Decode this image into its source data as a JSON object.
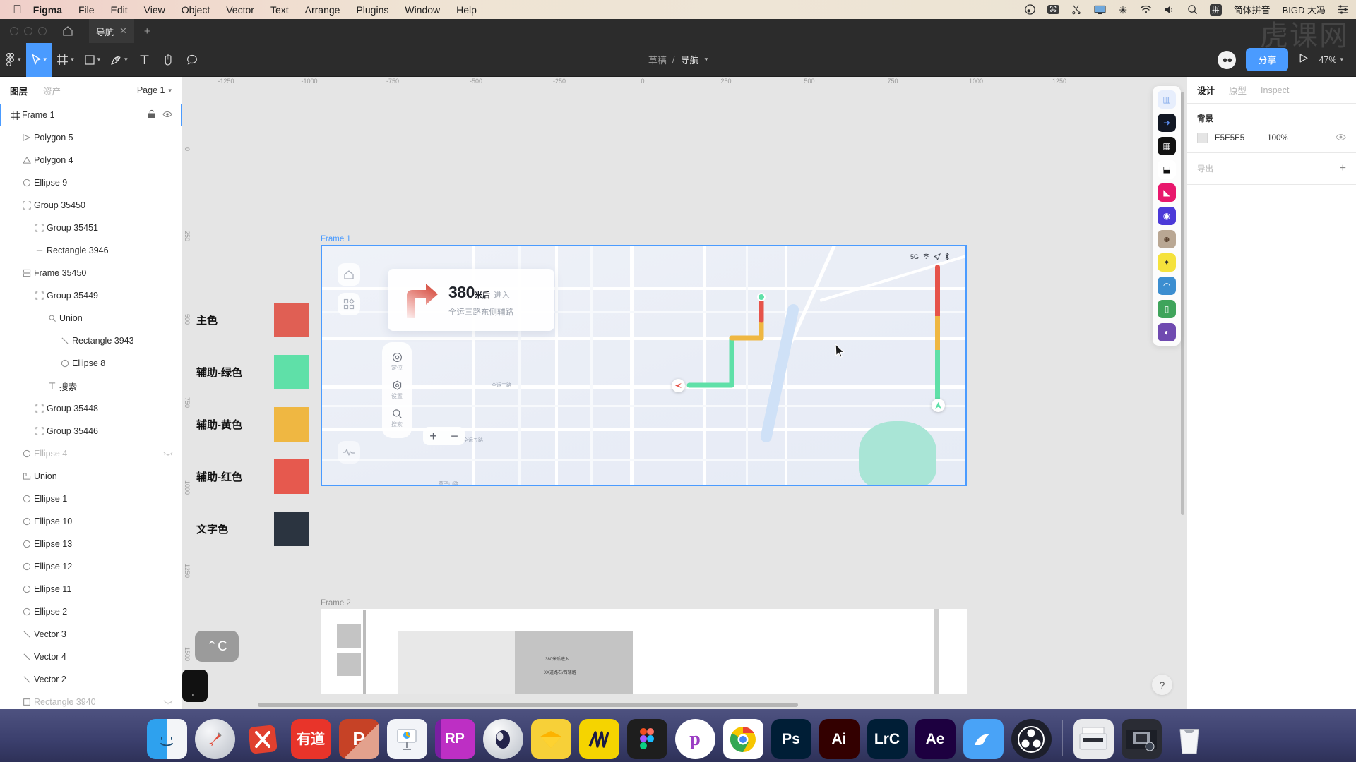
{
  "menubar": {
    "apple_icon": "apple-icon",
    "app_name": "Figma",
    "items": [
      "File",
      "Edit",
      "View",
      "Object",
      "Vector",
      "Text",
      "Arrange",
      "Plugins",
      "Window",
      "Help"
    ],
    "right_items": [
      {
        "name": "dropbox-icon",
        "glyph": "◍"
      },
      {
        "name": "command-key-icon",
        "glyph": "⌘"
      },
      {
        "name": "scissors-icon",
        "glyph": "✂"
      },
      {
        "name": "display-icon",
        "glyph": "🖵"
      },
      {
        "name": "airplay-icon",
        "glyph": "✛"
      },
      {
        "name": "wifi-icon",
        "glyph": "≋"
      },
      {
        "name": "volume-icon",
        "glyph": "◁"
      },
      {
        "name": "spotlight-search-icon",
        "glyph": "⌕"
      }
    ],
    "input_badge": "拼",
    "input_method": "简体拼音",
    "user_name": "BIGD 大冯",
    "control_center_icon": "control-center-icon"
  },
  "tabbar": {
    "tab_label": "导航",
    "close_glyph": "✕",
    "new_tab_glyph": "+",
    "home_icon": "figma-home-icon",
    "watermark": "虎课网"
  },
  "toolbar": {
    "tools": [
      {
        "name": "figma-menu-icon",
        "caret": true,
        "active": false
      },
      {
        "name": "move-tool-icon",
        "caret": true,
        "active": true
      },
      {
        "name": "frame-tool-icon",
        "caret": true,
        "active": false
      },
      {
        "name": "shape-tool-icon",
        "caret": true,
        "active": false
      },
      {
        "name": "pen-tool-icon",
        "caret": true,
        "active": false
      },
      {
        "name": "text-tool-icon",
        "caret": false,
        "active": false
      },
      {
        "name": "hand-tool-icon",
        "caret": false,
        "active": false
      },
      {
        "name": "comment-tool-icon",
        "caret": false,
        "active": false
      }
    ],
    "breadcrumb_project": "草稿",
    "breadcrumb_separator": "/",
    "breadcrumb_file": "导航",
    "share_label": "分享",
    "present_icon": "play-icon",
    "zoom_level": "47%"
  },
  "left_panel": {
    "tab_layers": "图层",
    "tab_assets": "资产",
    "page_name": "Page 1",
    "layers": [
      {
        "name": "Frame 1",
        "indent": 0,
        "icon": "frame-icon",
        "selected": true,
        "hidden": false,
        "locked": true,
        "eye": true
      },
      {
        "name": "Polygon 5",
        "indent": 1,
        "icon": "polygon-icon",
        "selected": false,
        "hidden": false
      },
      {
        "name": "Polygon 4",
        "indent": 1,
        "icon": "triangle-icon",
        "selected": false,
        "hidden": false
      },
      {
        "name": "Ellipse 9",
        "indent": 1,
        "icon": "ellipse-icon",
        "selected": false,
        "hidden": false
      },
      {
        "name": "Group 35450",
        "indent": 1,
        "icon": "group-icon",
        "selected": false,
        "hidden": false
      },
      {
        "name": "Group 35451",
        "indent": 2,
        "icon": "group-icon",
        "selected": false,
        "hidden": false
      },
      {
        "name": "Rectangle 3946",
        "indent": 2,
        "icon": "line-icon",
        "selected": false,
        "hidden": false
      },
      {
        "name": "Frame 35450",
        "indent": 1,
        "icon": "component-icon",
        "selected": false,
        "hidden": false
      },
      {
        "name": "Group 35449",
        "indent": 2,
        "icon": "group-icon",
        "selected": false,
        "hidden": false
      },
      {
        "name": "Union",
        "indent": 3,
        "icon": "union-search-icon",
        "selected": false,
        "hidden": false
      },
      {
        "name": "Rectangle 3943",
        "indent": 4,
        "icon": "vector-icon",
        "selected": false,
        "hidden": false
      },
      {
        "name": "Ellipse 8",
        "indent": 4,
        "icon": "ellipse-icon",
        "selected": false,
        "hidden": false
      },
      {
        "name": "搜索",
        "indent": 3,
        "icon": "text-icon",
        "selected": false,
        "hidden": false
      },
      {
        "name": "Group 35448",
        "indent": 2,
        "icon": "group-icon",
        "selected": false,
        "hidden": false
      },
      {
        "name": "Group 35446",
        "indent": 2,
        "icon": "group-icon",
        "selected": false,
        "hidden": false
      },
      {
        "name": "Ellipse 4",
        "indent": 1,
        "icon": "ellipse-icon",
        "selected": false,
        "hidden": true
      },
      {
        "name": "Union",
        "indent": 1,
        "icon": "union-icon",
        "selected": false,
        "hidden": false
      },
      {
        "name": "Ellipse 1",
        "indent": 1,
        "icon": "ellipse-icon",
        "selected": false,
        "hidden": false
      },
      {
        "name": "Ellipse 10",
        "indent": 1,
        "icon": "ellipse-icon",
        "selected": false,
        "hidden": false
      },
      {
        "name": "Ellipse 13",
        "indent": 1,
        "icon": "ellipse-icon",
        "selected": false,
        "hidden": false
      },
      {
        "name": "Ellipse 12",
        "indent": 1,
        "icon": "ellipse-icon",
        "selected": false,
        "hidden": false
      },
      {
        "name": "Ellipse 11",
        "indent": 1,
        "icon": "ellipse-icon",
        "selected": false,
        "hidden": false
      },
      {
        "name": "Ellipse 2",
        "indent": 1,
        "icon": "ellipse-icon",
        "selected": false,
        "hidden": false
      },
      {
        "name": "Vector 3",
        "indent": 1,
        "icon": "vector-icon",
        "selected": false,
        "hidden": false
      },
      {
        "name": "Vector 4",
        "indent": 1,
        "icon": "vector-icon",
        "selected": false,
        "hidden": false
      },
      {
        "name": "Vector 2",
        "indent": 1,
        "icon": "vector-icon",
        "selected": false,
        "hidden": false
      },
      {
        "name": "Rectangle 3940",
        "indent": 1,
        "icon": "rect-icon",
        "selected": false,
        "hidden": true
      }
    ]
  },
  "right_panel": {
    "tab_design": "设计",
    "tab_prototype": "原型",
    "tab_inspect": "Inspect",
    "background_title": "背景",
    "background_hex": "E5E5E5",
    "background_opacity": "100%",
    "export_title": "导出",
    "export_plus": "+"
  },
  "canvas": {
    "ruler_h": [
      "-1250",
      "-1000",
      "-750",
      "-500",
      "-250",
      "0",
      "250",
      "500",
      "750",
      "1000",
      "1250"
    ],
    "ruler_v": [
      "0",
      "250",
      "500",
      "750",
      "1000",
      "1250",
      "1500"
    ],
    "swatches": [
      {
        "label": "主色",
        "hex": "#E05F54"
      },
      {
        "label": "辅助-绿色",
        "hex": "#5FE0A8"
      },
      {
        "label": "辅助-黄色",
        "hex": "#EFB742"
      },
      {
        "label": "辅助-红色",
        "hex": "#E6594E"
      },
      {
        "label": "文字色",
        "hex": "#2B3440"
      }
    ],
    "frame1_label": "Frame 1",
    "frame2_label": "Frame 2",
    "map": {
      "status_network": "5G",
      "status_icons": [
        "wifi-icon",
        "location-arrow-icon",
        "bluetooth-icon"
      ],
      "nav_distance": "380",
      "nav_unit": "米后",
      "nav_action": "进入",
      "nav_road": "全运三路东侧辅路",
      "rail_items": [
        {
          "icon": "locate-icon",
          "label": "定位"
        },
        {
          "icon": "settings-icon",
          "label": "设置"
        },
        {
          "icon": "search-icon",
          "label": "搜索"
        }
      ],
      "zoom_in": "+",
      "zoom_out": "−",
      "home_icon": "home-icon",
      "apps_icon": "grid-apps-icon",
      "chart_icon": "chart-icon",
      "traffic_colors": [
        "#E6534A",
        "#EFB742",
        "#5FE0A8"
      ],
      "map_labels": [
        "全运三路",
        "全运五路",
        "莫子山路"
      ]
    },
    "frame2": {
      "placeholder_line1": "380米后进入",
      "placeholder_line2": "XX道路右/西辅路"
    },
    "key_hint": "⌃C",
    "key_hint2": "⌐"
  },
  "plugin_rail": [
    {
      "name": "plugin-contrast-icon",
      "bg": "#e7eefc",
      "glyph": "▥",
      "fg": "#7aa4e8"
    },
    {
      "name": "plugin-arrow-icon",
      "bg": "#121723",
      "glyph": "➜",
      "fg": "#5b8df0"
    },
    {
      "name": "plugin-qrcode-icon",
      "bg": "#111111",
      "glyph": "▦",
      "fg": "#ffffff"
    },
    {
      "name": "plugin-unsplash-icon",
      "bg": "#ffffff",
      "glyph": "⬓",
      "fg": "#111111"
    },
    {
      "name": "plugin-pink-icon",
      "bg": "#e8176c",
      "glyph": "◣",
      "fg": "#ffffff"
    },
    {
      "name": "plugin-blue-icon",
      "bg": "#4b39d8",
      "glyph": "◉",
      "fg": "#ffffff"
    },
    {
      "name": "plugin-avatar-icon",
      "bg": "#b9a793",
      "glyph": "☻",
      "fg": "#5e4633"
    },
    {
      "name": "plugin-sparkle-icon",
      "bg": "#f5e23c",
      "glyph": "✦",
      "fg": "#2b2b2b"
    },
    {
      "name": "plugin-bucket-icon",
      "bg": "#3c8ed0",
      "glyph": "◠",
      "fg": "#ffffff"
    },
    {
      "name": "plugin-green-icon",
      "bg": "#3fa45b",
      "glyph": "▯",
      "fg": "#ffffff"
    },
    {
      "name": "plugin-gauge-icon",
      "bg": "#6f4ab0",
      "glyph": "◐",
      "fg": "#ffffff"
    }
  ],
  "help_button": "?",
  "dock": {
    "items": [
      {
        "name": "finder",
        "label": "",
        "bg": "#3aa0e8",
        "running": true
      },
      {
        "name": "launchpad",
        "label": "",
        "bg": "#c9ccd2",
        "running": false
      },
      {
        "name": "xmind",
        "label": "✕",
        "bg": "#e0402f",
        "running": false
      },
      {
        "name": "youdao",
        "label": "有道",
        "bg": "#e8342a",
        "running": false
      },
      {
        "name": "powerpoint",
        "label": "P",
        "bg": "#c64226",
        "running": true
      },
      {
        "name": "keynote",
        "label": "",
        "bg": "#f2f4f8",
        "running": false
      },
      {
        "name": "axure-rp",
        "label": "RP",
        "bg": "#a32ba8",
        "running": false
      },
      {
        "name": "cinema4d",
        "label": "",
        "bg": "#cfd4dd",
        "running": false
      },
      {
        "name": "sketch",
        "label": "◆",
        "bg": "#f7b500",
        "running": false
      },
      {
        "name": "mockplus",
        "label": "⫼",
        "bg": "#f5d400",
        "running": false
      },
      {
        "name": "figma",
        "label": "",
        "bg": "#1e1e1e",
        "running": false
      },
      {
        "name": "xunjie-pdf",
        "label": "p",
        "bg": "#ffffff",
        "running": false
      },
      {
        "name": "chrome",
        "label": "",
        "bg": "#ffffff",
        "running": true
      },
      {
        "name": "photoshop",
        "label": "Ps",
        "bg": "#001e36",
        "running": false
      },
      {
        "name": "illustrator",
        "label": "Ai",
        "bg": "#330000",
        "running": false
      },
      {
        "name": "lightroom",
        "label": "LrC",
        "bg": "#001e36",
        "running": false
      },
      {
        "name": "aftereffects",
        "label": "Ae",
        "bg": "#1d0040",
        "running": false
      },
      {
        "name": "browser",
        "label": "",
        "bg": "#49a3f7",
        "running": false
      },
      {
        "name": "obs-studio",
        "label": "",
        "bg": "#2b2f52",
        "running": true
      },
      {
        "name": "printer",
        "label": "",
        "bg": "#e9eaec",
        "running": false
      },
      {
        "name": "screenshot",
        "label": "",
        "bg": "#2a2c34",
        "running": false
      },
      {
        "name": "trash",
        "label": "",
        "bg": "#f2f2f2",
        "running": false
      }
    ]
  }
}
